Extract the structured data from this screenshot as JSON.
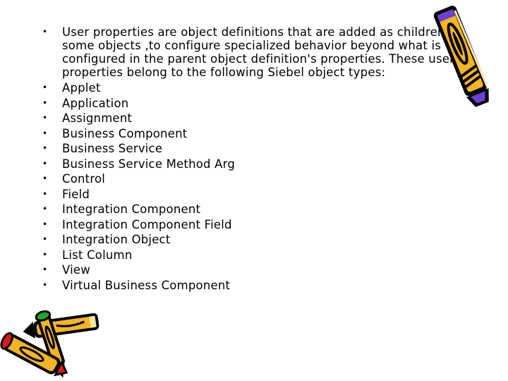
{
  "slide": {
    "intro": "User properties are object definitions that are added as children to some objects ,to configure specialized behavior beyond what is configured in the parent object definition's properties. These user properties belong to the following Siebel object types:",
    "items": [
      "Applet",
      "Application",
      "Assignment",
      "Business Component",
      "Business Service",
      "Business Service Method Arg",
      "Control",
      "Field",
      "Integration Component",
      "Integration Component Field",
      "Integration Object",
      "List Column",
      "View",
      "Virtual Business Component"
    ],
    "bullet_glyph": "•"
  },
  "colors": {
    "crayon_body": "#f5b523",
    "crayon_tip_top": "#6a3fd6",
    "crayon_cap_green": "#1fa82a",
    "crayon_cap_red": "#e01818",
    "outline": "#000000"
  }
}
